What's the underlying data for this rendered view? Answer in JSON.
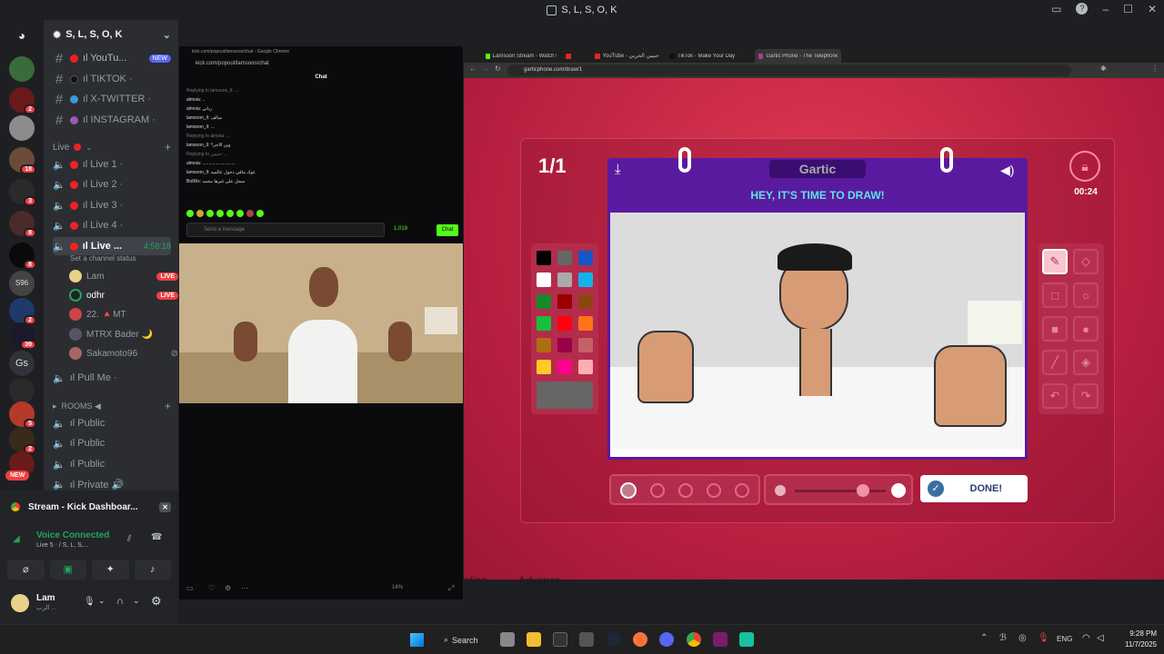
{
  "window": {
    "title": "S, L, S, O, K"
  },
  "server": {
    "name": "S, L, S, O, K"
  },
  "channels": [
    {
      "label": "ıl YouTu...",
      "badge": "NEW"
    },
    {
      "label": "ıl TIKTOK ·"
    },
    {
      "label": "ıl X-TWITTER ·"
    },
    {
      "label": "ıl INSTAGRAM ·"
    }
  ],
  "live_category": "Live",
  "voice_channels": [
    {
      "label": "ıl Live 1 ·"
    },
    {
      "label": "ıl Live 2 ·"
    },
    {
      "label": "ıl Live 3 ·"
    },
    {
      "label": "ıl Live 4 ·"
    }
  ],
  "active_voice": {
    "label": "ıl Live ...",
    "timer": "4:58:18",
    "status": "Set a channel status"
  },
  "voice_users": [
    {
      "name": "Lam",
      "live": "LIVE"
    },
    {
      "name": "odhr",
      "live": "LIVE"
    },
    {
      "name": "22. 🔺MT"
    },
    {
      "name": "MTRX Bader 🌙"
    },
    {
      "name": "Sakamoto96"
    }
  ],
  "pull_me": "ıl Pull Me ·",
  "rooms_category": "ROOMS ◀",
  "rooms": [
    {
      "label": "ıl Public"
    },
    {
      "label": "ıl Public"
    },
    {
      "label": "ıl Public"
    },
    {
      "label": "ıl Private 🔊"
    }
  ],
  "new_pill": "NEW",
  "stream_card": {
    "title": "Stream - Kick Dashboar..."
  },
  "voice": {
    "status": "Voice Connected",
    "sub": "Live 5 · / S, L, S,..."
  },
  "user": {
    "name": "Lam",
    "status": "الرب ..."
  },
  "servers": [
    {
      "color": "#3a6b3a",
      "badge": ""
    },
    {
      "color": "#6a1a1a",
      "badge": "2"
    },
    {
      "color": "#8c8c8c",
      "badge": ""
    },
    {
      "color": "#6b4a3a",
      "badge": "18"
    },
    {
      "color": "#2a2a2a",
      "badge": "3"
    },
    {
      "color": "#4a2a2a",
      "badge": "8"
    },
    {
      "color": "#0a0a0a",
      "badge": "8"
    },
    {
      "color": "#444",
      "badge": ""
    },
    {
      "color": "#1e3a6a",
      "badge": "2"
    },
    {
      "color": "#1a1a2a",
      "badge": "39"
    },
    {
      "color": "#2a2a2a",
      "badge": ""
    },
    {
      "color": "#b53a2a",
      "badge": "5"
    },
    {
      "color": "#3a2a1a",
      "badge": "2"
    },
    {
      "color": "#6a1a1a",
      "badge": ""
    }
  ],
  "server_text": {
    "gs": "Gs",
    "s96": "S96"
  },
  "kick": {
    "window_title": "kick.com/popout/lamsoon/chat - Google Chrome",
    "url": "kick.com/popout/lamsoon/chat",
    "chat_header": "Chat",
    "messages": [
      "Replying to lamsoon_ll: ...",
      "almoia: ..",
      "almoia: رباني",
      "lamsoon_ll: سالف",
      "lamsoon_ll: ...",
      "Replying to almoia: ...",
      "lamsoon_ll: وين الاجر؟",
      "Replying to حبيبي: ...",
      "almoia: ..........................",
      "lamsoon_ll: عوك مافي دخول عالميه",
      "BotRix: سجل على غيرها محمد"
    ],
    "input_placeholder": "Send a message",
    "viewers": "1,019",
    "chat_button": "Chat",
    "zoom": "14%"
  },
  "chrome": {
    "tabs": [
      "Lamsoon Stream - Watch Live o...",
      "",
      "YouTube - حبيبي الحربي ...",
      "TikTok - Make Your Day",
      "Gartic Phone - The Telephone ..."
    ],
    "url": "garticphone.com/draw/1"
  },
  "game": {
    "round": "1/1",
    "logo": "Gartic",
    "header": "HEY, IT'S TIME TO DRAW!",
    "timer": "00:24",
    "done": "DONE!",
    "ghost_left": "ation",
    "ghost_mid": "Advance",
    "palette": [
      "#000000",
      "#666666",
      "#1656c9",
      "#ffffff",
      "#aaaaaa",
      "#11b3ee",
      "#158a2b",
      "#990000",
      "#8c4612",
      "#15c13b",
      "#ff0013",
      "#ff7416",
      "#b06d10",
      "#990047",
      "#c36266",
      "#ffc926",
      "#ff008f",
      "#feaeb0"
    ]
  },
  "taskbar": {
    "search": "Search",
    "lang": "ENG",
    "time": "9:28 PM",
    "date": "11/7/2025"
  }
}
